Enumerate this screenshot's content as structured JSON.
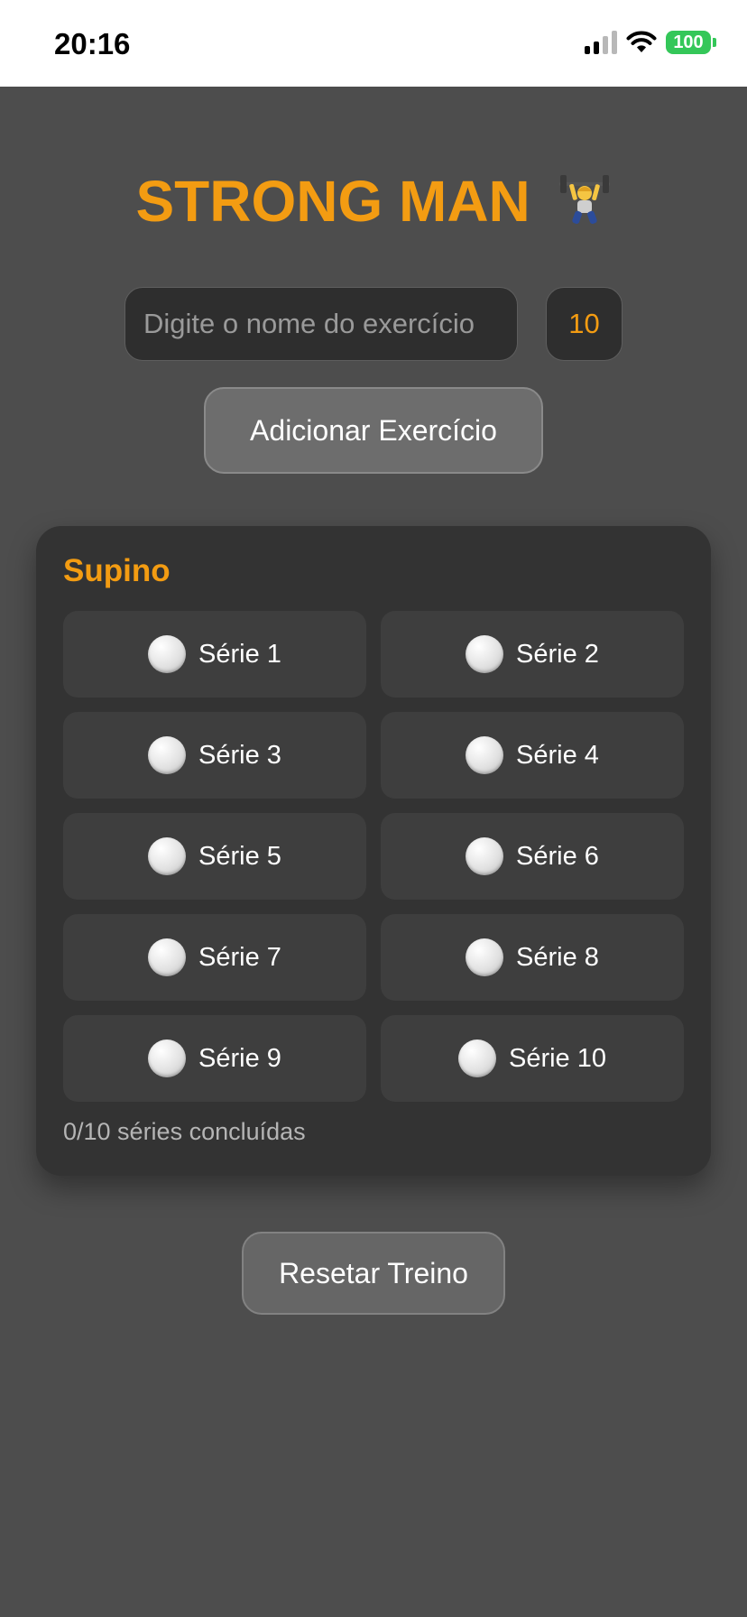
{
  "status_bar": {
    "time": "20:16",
    "battery": "100",
    "icons": [
      "signal-icon",
      "wifi-icon",
      "battery-icon"
    ]
  },
  "app": {
    "title": "STRONG MAN",
    "title_icon": "weightlifter-icon",
    "accent_color": "#f39c12"
  },
  "form": {
    "name_placeholder": "Digite o nome do exercício",
    "name_value": "",
    "sets_value": "10",
    "add_label": "Adicionar Exercício"
  },
  "exercise": {
    "name": "Supino",
    "series": [
      {
        "label": "Série 1",
        "done": false
      },
      {
        "label": "Série 2",
        "done": false
      },
      {
        "label": "Série 3",
        "done": false
      },
      {
        "label": "Série 4",
        "done": false
      },
      {
        "label": "Série 5",
        "done": false
      },
      {
        "label": "Série 6",
        "done": false
      },
      {
        "label": "Série 7",
        "done": false
      },
      {
        "label": "Série 8",
        "done": false
      },
      {
        "label": "Série 9",
        "done": false
      },
      {
        "label": "Série 10",
        "done": false
      }
    ],
    "progress": "0/10 séries concluídas"
  },
  "actions": {
    "reset_label": "Resetar Treino"
  }
}
